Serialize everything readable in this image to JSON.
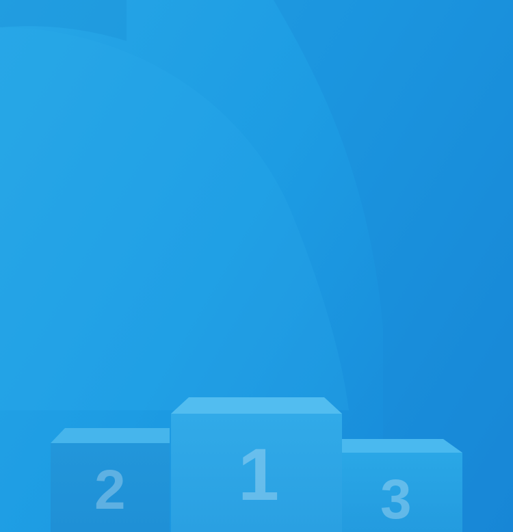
{
  "podium": {
    "first": "1",
    "second": "2",
    "third": "3"
  },
  "colors": {
    "background_light": "#27a6e6",
    "background_dark": "#1685d6",
    "podium_top": "#4ab9ef",
    "podium_front": "#2aa3e4"
  }
}
